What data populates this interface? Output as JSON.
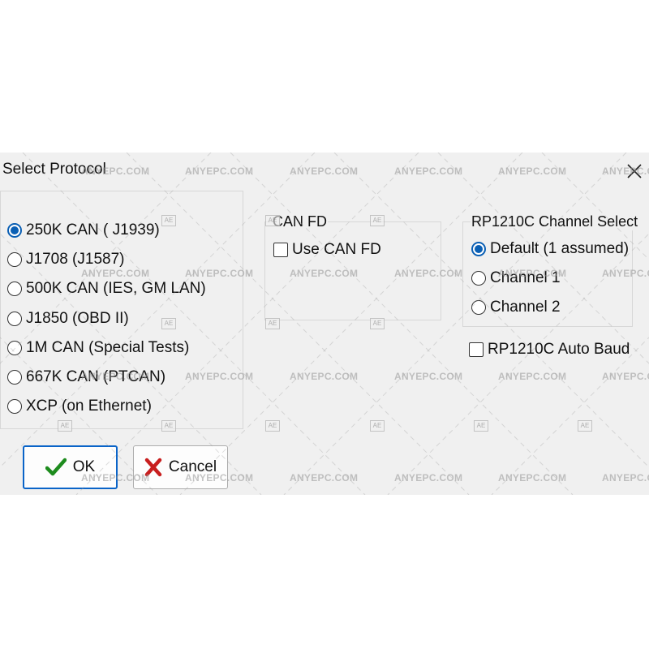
{
  "dialog": {
    "title": "Select Protocol",
    "close_icon": "close-icon"
  },
  "protocols": {
    "options": [
      {
        "label": "250K CAN ( J1939)",
        "selected": true
      },
      {
        "label": "J1708 (J1587)",
        "selected": false
      },
      {
        "label": "500K CAN (IES, GM LAN)",
        "selected": false
      },
      {
        "label": "J1850 (OBD II)",
        "selected": false
      },
      {
        "label": "1M CAN (Special Tests)",
        "selected": false
      },
      {
        "label": "667K CAN (PTCAN)",
        "selected": false
      },
      {
        "label": "XCP (on Ethernet)",
        "selected": false
      }
    ]
  },
  "can_fd": {
    "legend": "CAN FD",
    "use_label": "Use CAN FD",
    "checked": false
  },
  "rp1210": {
    "legend": "RP1210C Channel Select",
    "options": [
      {
        "label": "Default (1 assumed)",
        "selected": true
      },
      {
        "label": "Channel 1",
        "selected": false
      },
      {
        "label": "Channel 2",
        "selected": false
      }
    ],
    "auto_baud_label": "RP1210C Auto Baud",
    "auto_baud_checked": false
  },
  "buttons": {
    "ok_label": "OK",
    "cancel_label": "Cancel",
    "ok_icon": "checkmark-icon",
    "cancel_icon": "x-mark-icon"
  },
  "watermark": {
    "text": "ANYEPC.COM",
    "badge": "AE"
  },
  "colors": {
    "dialog_bg": "#f0f0f0",
    "accent": "#0a5fb4",
    "ok_check": "#1e8c1e",
    "cancel_x": "#c81e1e"
  }
}
